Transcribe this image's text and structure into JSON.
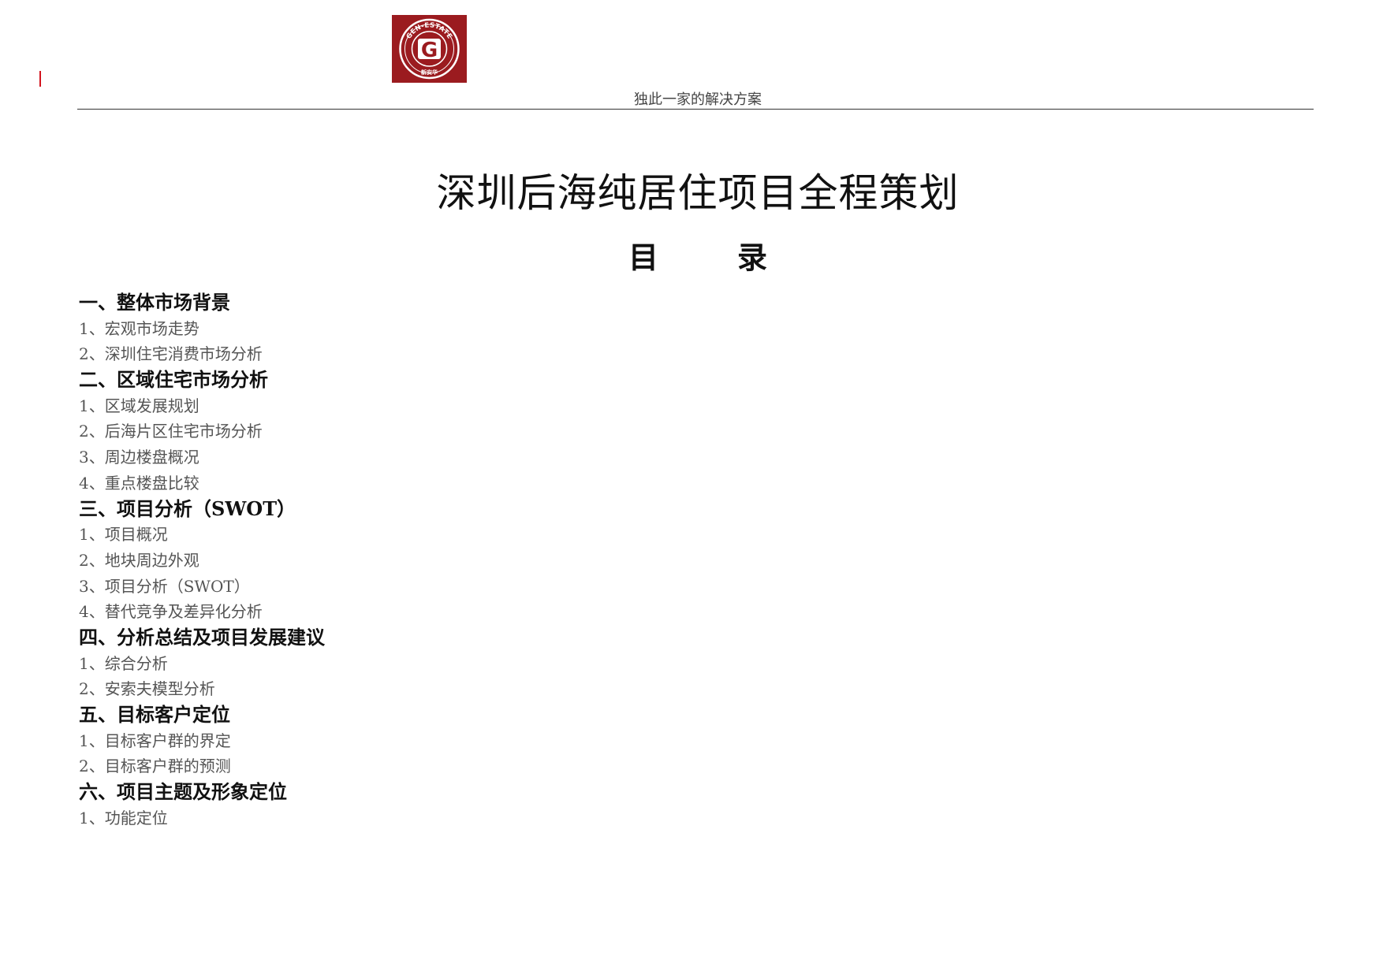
{
  "header": {
    "logo": {
      "ring_text": "GEN-ESTATE",
      "letter": "G",
      "bottom_text": "新安华",
      "bg_color": "#9b1b1f",
      "ring_color": "#ffffff"
    },
    "tagline": "独此一家的解决方案",
    "accent_color": "#d3141f"
  },
  "document": {
    "title": "深圳后海纯居住项目全程策划",
    "toc_heading": "目录"
  },
  "toc": [
    {
      "type": "section",
      "text": "一、整体市场背景"
    },
    {
      "type": "item",
      "text": "1、宏观市场走势"
    },
    {
      "type": "item",
      "text": "2、深圳住宅消费市场分析"
    },
    {
      "type": "section",
      "text": "二、区域住宅市场分析"
    },
    {
      "type": "item",
      "text": "1、区域发展规划"
    },
    {
      "type": "item",
      "text": "2、后海片区住宅市场分析"
    },
    {
      "type": "item",
      "text": "3、周边楼盘概况"
    },
    {
      "type": "item",
      "text": "4、重点楼盘比较"
    },
    {
      "type": "section",
      "text": "三、项目分析（SWOT）"
    },
    {
      "type": "item",
      "text": "1、项目概况"
    },
    {
      "type": "item",
      "text": "2、地块周边外观"
    },
    {
      "type": "item",
      "text": "3、项目分析（SWOT）"
    },
    {
      "type": "item",
      "text": "4、替代竞争及差异化分析"
    },
    {
      "type": "section",
      "text": "四、分析总结及项目发展建议"
    },
    {
      "type": "item",
      "text": "1、综合分析"
    },
    {
      "type": "item",
      "text": "2、安索夫模型分析"
    },
    {
      "type": "section",
      "text": "五、目标客户定位"
    },
    {
      "type": "item",
      "text": "1、目标客户群的界定"
    },
    {
      "type": "item",
      "text": "2、目标客户群的预测"
    },
    {
      "type": "section",
      "text": "六、项目主题及形象定位"
    },
    {
      "type": "item",
      "text": "1、功能定位"
    }
  ]
}
